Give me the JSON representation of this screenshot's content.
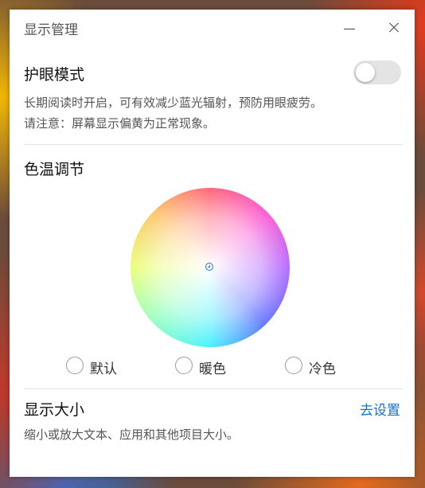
{
  "window": {
    "title": "显示管理"
  },
  "eye_care": {
    "title": "护眼模式",
    "toggle_on": false,
    "desc_line1": "长期阅读时开启，可有效减少蓝光辐射，预防用眼疲劳。",
    "desc_line2": "请注意：屏幕显示偏黄为正常现象。"
  },
  "color_temp": {
    "title": "色温调节",
    "options": [
      {
        "label": "默认",
        "selected": false
      },
      {
        "label": "暖色",
        "selected": false
      },
      {
        "label": "冷色",
        "selected": false
      }
    ]
  },
  "display_size": {
    "title": "显示大小",
    "link": "去设置",
    "desc": "缩小或放大文本、应用和其他项目大小。"
  },
  "colors": {
    "accent": "#1673c7"
  }
}
